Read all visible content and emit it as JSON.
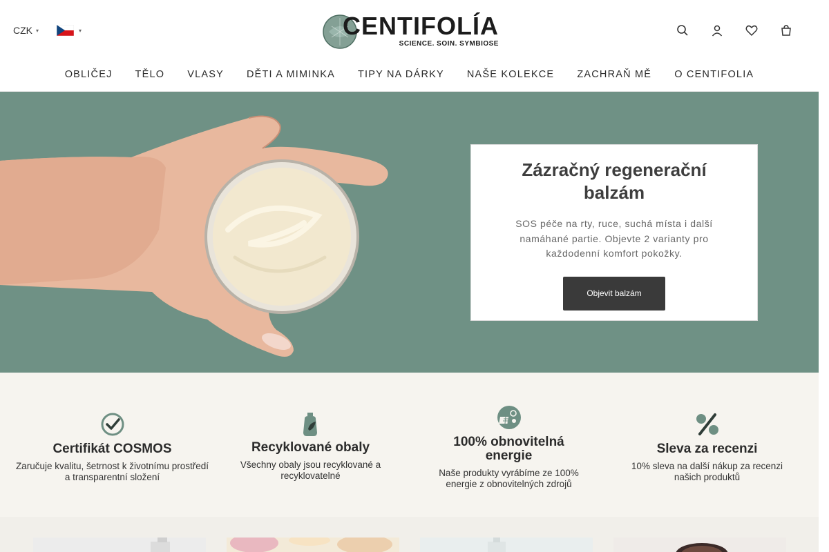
{
  "header": {
    "currency": "CZK",
    "logo": {
      "word": "CENTIFOLIA",
      "accent": "Í",
      "tagline": "SCIENCE. SOIN. SYMBIOSE"
    },
    "icons": [
      "search-icon",
      "user-icon",
      "heart-icon",
      "cart-icon"
    ]
  },
  "nav": {
    "items": [
      "OBLIČEJ",
      "TĚLO",
      "VLASY",
      "DĚTI A MIMINKA",
      "TIPY NA DÁRKY",
      "NAŠE KOLEKCE",
      "ZACHRAŇ MĚ",
      "O CENTIFOLIA"
    ]
  },
  "hero": {
    "title": "Zázračný regenerační balzám",
    "text": "SOS péče na rty, ruce, suchá místa i další namáhané partie. Objevte 2 varianty pro každodenní komfort pokožky.",
    "button": "Objevit balzám",
    "colors": {
      "background": "#6f9185",
      "button": "#3a3a3a"
    }
  },
  "features": [
    {
      "title": "Certifikát COSMOS",
      "desc": "Zaručuje kvalitu, šetrnost k životnímu prostředí a transparentní složení",
      "icon": "cosmos-check-icon"
    },
    {
      "title": "Recyklované obaly",
      "desc": "Všechny obaly jsou recyklované a recyklovatelné",
      "icon": "recycled-bottle-icon"
    },
    {
      "title": "100% obnovitelná energie",
      "desc": "Naše produkty vyrábíme ze 100% energie z obnovitelných zdrojů",
      "icon": "solar-energy-icon"
    },
    {
      "title": "Sleva za recenzi",
      "desc": "10% sleva na další nákup za recenzi našich produktů",
      "icon": "percent-icon"
    }
  ],
  "colors": {
    "brand_green": "#6f9185",
    "icon_green": "#6e8f83",
    "features_bg": "#f6f4ef"
  }
}
